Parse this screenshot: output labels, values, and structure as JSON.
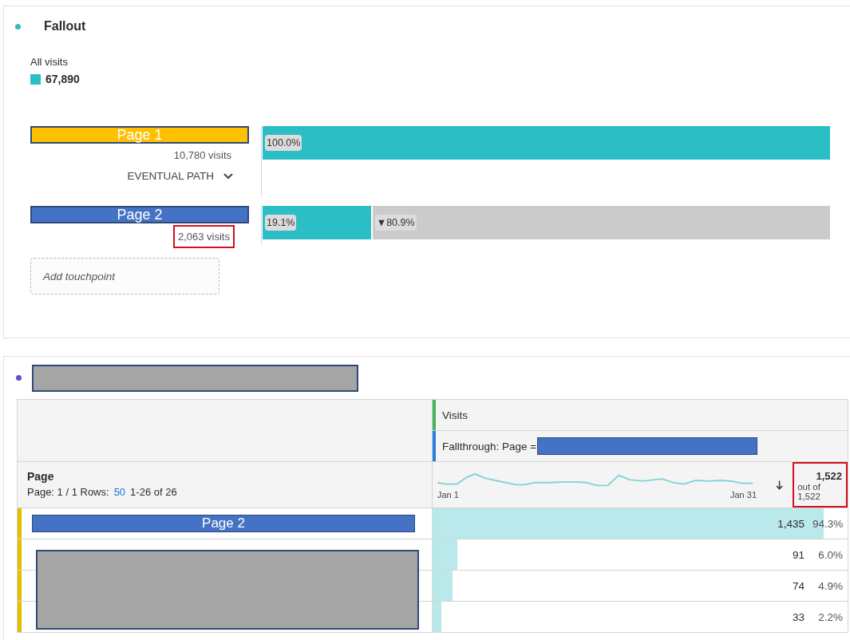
{
  "fallout": {
    "title": "Fallout",
    "segment": {
      "label": "All visits",
      "value": "67,890"
    },
    "steps": [
      {
        "label": "Page 1",
        "color": "#ffc000",
        "visits": "10,780 visits",
        "highlighted": false,
        "menu": "EVENTUAL PATH",
        "level": 1,
        "reading": "100.0%"
      },
      {
        "label": "Page 2",
        "color": "#4472c4",
        "visits": "2,063 visits",
        "highlighted": true,
        "level": 0.191,
        "reading": "19.1%",
        "fallout": "▼80.9%"
      }
    ],
    "add_placeholder": "Add touchpoint"
  },
  "table": {
    "metric": "Visits",
    "segment": "Fallthrough: Page =",
    "dimension": "Page",
    "pagination": {
      "prefix": "Page: 1 / 1 Rows:",
      "rows": "50",
      "range": "1-26 of 26"
    },
    "trend": {
      "start": "Jan 1",
      "end": "Jan 31"
    },
    "total": "1,522",
    "total_sub": "out of 1,522",
    "total_highlighted": true,
    "rows": [
      {
        "label": "Page 2",
        "value": "1,435",
        "percent": "94.3%",
        "level": 0.943
      },
      {
        "value": "91",
        "percent": "6.0%",
        "level": 0.06
      },
      {
        "value": "74",
        "percent": "4.9%",
        "level": 0.049
      },
      {
        "value": "33",
        "percent": "2.2%",
        "level": 0.022
      }
    ]
  }
}
